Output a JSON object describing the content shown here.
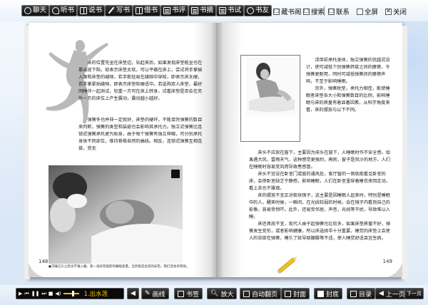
{
  "toolbar": {
    "chat": "聊天",
    "listen": "听书",
    "tell": "说书",
    "write": "写书",
    "borrow": "借书",
    "review": "书评",
    "excerpt": "书摘",
    "bookmark": "书试",
    "friend": "书友",
    "hide_bookmark": "藏书阁",
    "search": "搜索",
    "contact": "联系",
    "fullscreen": "全屏",
    "close": "关闭"
  },
  "left_page": {
    "paragraphs": [
      "床的位置先坐在床垫边，钻起来后，如果发现床垫能坐也在靠出现下陷，就表示床垫太软，可以平躺在床上，尝试将手掌插入腰和床垫的缝隙，若手能轻易在缝隙中穿梭，即表示床太硬，若手掌紧贴缝隙，即表示床垫软硬适中。若选购双人床垫，最好同睡伴一起测试，较重一方可在床上转身，试看床垫是否会在另外一方的床位上产生震动，震动越小越好。",
      "弹簧冬也并非一定就好，床垫的硬环，不能单凭弹簧的数目来判断，弹簧的类型和装嵌也会影响其承托力。独立式弹簧比连锁式弹簧承托更为贴身，由于每个弹簧有独立伸缩，可分别承托身体不同部位，维持脊椎自然的曲线。相反，连锁式弹簧互相连接，受无"
    ],
    "caption": "●沉睡已久之后也不难入睡，第一张床垫能影响睡眠质量。当然挑选合适的床垫，我们还会有帮助。",
    "page_number": "148"
  },
  "right_page": {
    "paragraphs_top": [
      "活但却承托身体，独立弹簧的优越式设计，使可减低个别弹簧转接之间的摩擦，令弹簧更耐用，同时可减低弹簧间的摩擦声响，不至于影响睡眠。",
      "另外，弹簧枕垫，承托力相佳，能使睡眠者床垫各大小和弹簧数目的比例，影响睡眠与床的质量有着显著因素。从科学角度来看，床的摆放与以下不同。"
    ],
    "paragraphs_bottom": [
      "床头不应放在窗下，主要因为床头在窗下，人睡眠时作不安全感，如果遇大风，雷雨天气，这种感觉更强烈，再则，窗子是风沙的地方，人们在睡眠时容易受风而导致患感冒。",
      "床头不宜设在卧室门或窗的通风处，客厅窗的一侧就能看见卧室的床，会使卧室缺乏宁静感，影响睡眠，人们在卧室里穿着睡衣来回走动，看上去也不雅观。",
      "床的摆放不宜正对梳妆镜子，这主要是因睡眠人起来时，特别是睡眠中的人，醒来时候，一瞬间，在光线较弱的时候，会在镜子内看到自己的影像，容易受惊吓。此外，还易受邻居，声音，光线等干扰，导致难以入睡。",
      "床还具底不宜，现代人由于起弹簧也比较多，如果床垫质量不好，弹簧发生变形，或者影响健康，所以床选择中十分重要，睡觉的床垫上会使人的背部在弹簧，睡久了就导致腰酸等不适，使人睡觉舒适且宜生病。"
    ],
    "page_number": "149"
  },
  "player": {
    "track": "1.出水莲"
  },
  "bottom_bar": {
    "draw": "画线",
    "bookmark": "书签",
    "zoom": "放大",
    "auto_flip": "自动翻页",
    "cover_front": "封面",
    "cover_back": "封底",
    "contents": "目录",
    "prev": "上一页",
    "next": "下一页"
  },
  "colors": {
    "button_bg": "#111111",
    "accent": "#f4c400",
    "page": "#ffffff"
  }
}
